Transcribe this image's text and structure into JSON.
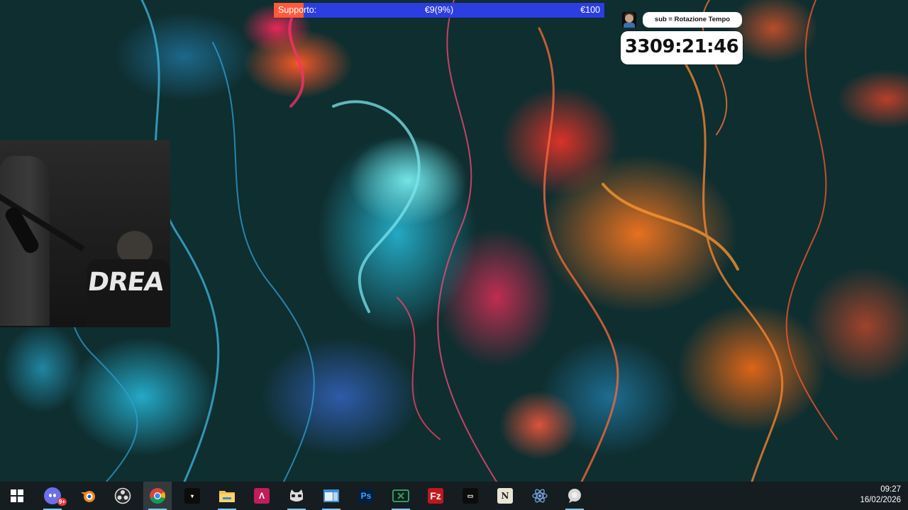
{
  "donation_bar": {
    "label": "Supporto:",
    "current": "€9(9%)",
    "goal": "€100",
    "progress_percent": 9,
    "fill_color": "#ff5a3c",
    "bar_color": "#2d3ee0"
  },
  "timer_widget": {
    "sub_rule": "sub = Rotazione Tempo",
    "timer": "3309:21:46"
  },
  "webcam": {
    "shirt_text": "DREA"
  },
  "taskbar": {
    "items": [
      {
        "name": "start-button",
        "icon": "windows-icon"
      },
      {
        "name": "discord",
        "icon": "discord-icon",
        "badge": "9+"
      },
      {
        "name": "blender",
        "icon": "blender-icon"
      },
      {
        "name": "obs-studio",
        "icon": "obs-icon"
      },
      {
        "name": "google-chrome",
        "icon": "chrome-icon",
        "active": true
      },
      {
        "name": "terminal",
        "icon": "terminal-icon"
      },
      {
        "name": "file-explorer",
        "icon": "folder-icon"
      },
      {
        "name": "affinity",
        "icon": "affinity-icon"
      },
      {
        "name": "streaming-app",
        "icon": "cat-icon"
      },
      {
        "name": "window-app",
        "icon": "window-icon"
      },
      {
        "name": "photoshop",
        "icon": "photoshop-icon",
        "text": "Ps"
      },
      {
        "name": "excel",
        "icon": "excel-icon"
      },
      {
        "name": "filezilla",
        "icon": "filezilla-icon"
      },
      {
        "name": "small-app",
        "icon": "app-icon"
      },
      {
        "name": "notepad-app",
        "icon": "notepad-icon",
        "text": "N"
      },
      {
        "name": "atom",
        "icon": "atom-icon"
      },
      {
        "name": "chat-app",
        "icon": "chat-bubble-icon"
      }
    ],
    "clock_time": "09:27",
    "clock_date": "16/02/2026"
  }
}
